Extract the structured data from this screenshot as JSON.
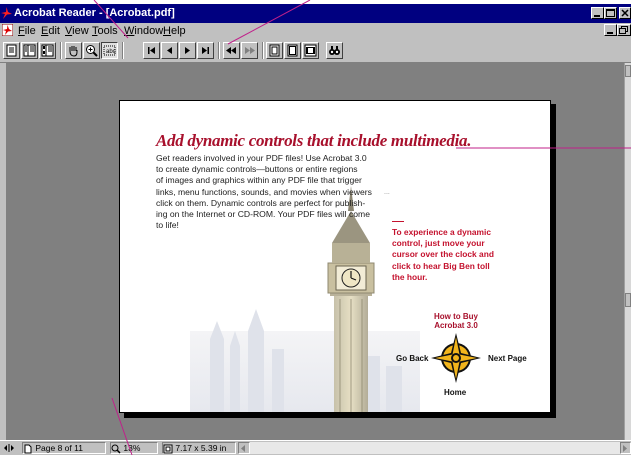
{
  "window": {
    "title": "Acrobat Reader - [Acrobat.pdf]"
  },
  "menu": {
    "items": [
      {
        "label": "File",
        "key": "F"
      },
      {
        "label": "Edit",
        "key": "E"
      },
      {
        "label": "View",
        "key": "V"
      },
      {
        "label": "Tools",
        "key": "T"
      },
      {
        "label": "Window",
        "key": "W"
      },
      {
        "label": "Help",
        "key": "H"
      }
    ]
  },
  "toolbar": {
    "buttons": [
      "page-only-icon",
      "bookmarks-and-page-icon",
      "thumbnails-and-page-icon",
      "hand-tool-icon",
      "zoom-tool-icon",
      "text-select-tool-icon",
      "first-page-icon",
      "previous-page-icon",
      "next-page-icon",
      "last-page-icon",
      "go-back-icon",
      "go-forward-icon",
      "actual-size-icon",
      "fit-page-icon",
      "fit-width-icon",
      "find-icon"
    ]
  },
  "document": {
    "heading": "Add dynamic controls that include multimedia.",
    "body_lines": [
      "Get readers involved in your PDF files! Use Acrobat 3.0",
      "to create dynamic controls—buttons or entire regions",
      "of images and graphics within any PDF file that trigger",
      "links, menu functions, sounds, and movies when viewers",
      "click on them. Dynamic controls are perfect for publish-",
      "ing on the Internet or CD-ROM. Your PDF files will come",
      "to life!"
    ],
    "red_lines": [
      "To experience a dynamic",
      "control, just move your",
      "cursor over the clock and",
      "click to hear Big Ben toll",
      "the hour."
    ],
    "how_to_buy_lines": [
      "How to Buy",
      "Acrobat 3.0"
    ],
    "nav": {
      "back": "Go Back",
      "next": "Next Page",
      "home": "Home"
    }
  },
  "status": {
    "page": "Page 8 of 11",
    "zoom": "13%",
    "size": "7.17 x 5.39 in"
  },
  "colors": {
    "title_bar": "#000080",
    "chrome": "#c0c0c0",
    "heading_red": "#a8102c",
    "callout_magenta": "#c0208a"
  }
}
